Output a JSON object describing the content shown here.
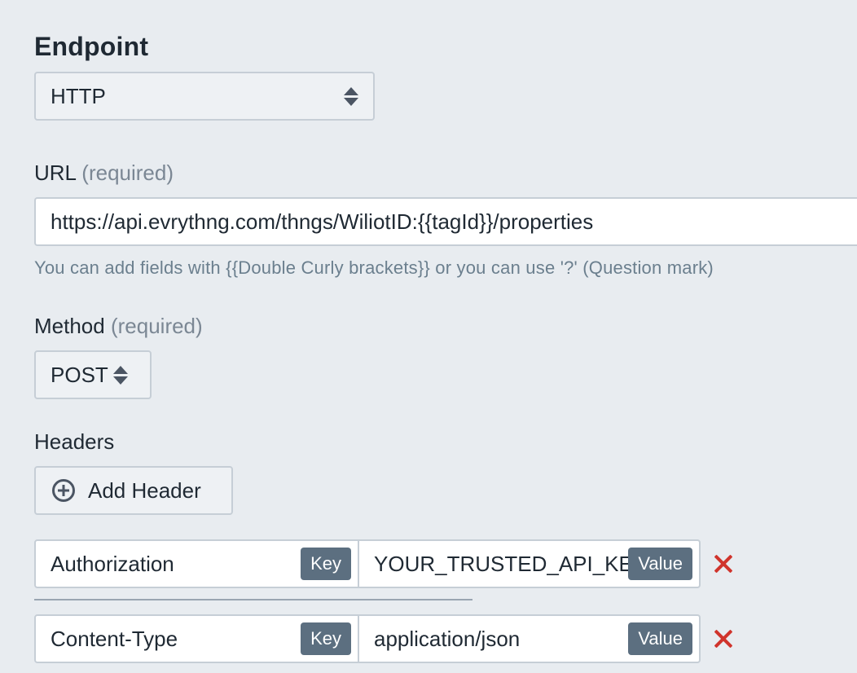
{
  "endpoint": {
    "title": "Endpoint",
    "type_value": "HTTP"
  },
  "url": {
    "label": "URL",
    "required_text": "(required)",
    "value": "https://api.evrythng.com/thngs/WiliotID:{{tagId}}/properties",
    "help": "You can add fields with {{Double Curly brackets}} or you can use '?' (Question mark)"
  },
  "method": {
    "label": "Method",
    "required_text": "(required)",
    "value": "POST"
  },
  "headers": {
    "label": "Headers",
    "add_button_label": "Add Header",
    "key_tag": "Key",
    "value_tag": "Value",
    "rows": [
      {
        "key": "Authorization",
        "value": "YOUR_TRUSTED_API_KEY"
      },
      {
        "key": "Content-Type",
        "value": "application/json"
      }
    ]
  },
  "icons": {
    "select_arrows": "up-down-chevron-icon",
    "add": "plus-circle-icon",
    "remove": "close-x-icon"
  },
  "colors": {
    "background": "#e8ecf0",
    "tag": "#5c6f80",
    "remove": "#d0342c",
    "help_text": "#6b7f8e"
  }
}
